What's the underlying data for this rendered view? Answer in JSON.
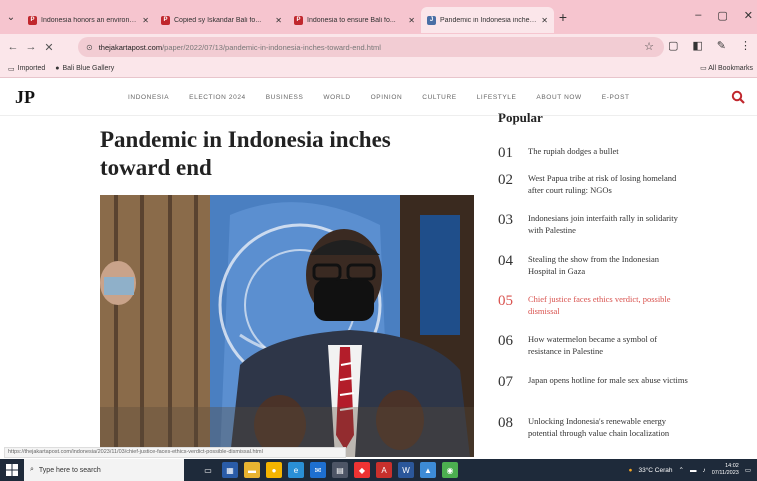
{
  "browser": {
    "tabs": [
      {
        "label": "Indonesia honors an environmental ...",
        "fav": "P",
        "fav_color": "#c0272d"
      },
      {
        "label": "Copied sy Iskandar Bali fo...",
        "fav": "P",
        "fav_color": "#c0272d"
      },
      {
        "label": "Indonesia to ensure Bali fo...",
        "fav": "P",
        "fav_color": "#c0272d"
      },
      {
        "label": "Pandemic in Indonesia inches ...",
        "fav": "J",
        "fav_color": "#4a6fa5"
      }
    ],
    "new_tab": "+",
    "window_controls": {
      "minimize": "–",
      "maximize": "▢",
      "close": "✕"
    },
    "nav": {
      "back": "←",
      "forward": "→",
      "reload": "✕",
      "site_info": "⊙"
    },
    "address": {
      "host": "thejakartapost.com",
      "path": "/paper/2022/07/13/pandemic-in-indonesia-inches-toward-end.html"
    },
    "star": "☆",
    "toolbar_icons": [
      "▢",
      "◧",
      "✎",
      "⋮"
    ],
    "bookmarks": [
      {
        "label": "Imported",
        "icon": "▭"
      },
      {
        "label": "Bali Blue Gallery",
        "icon": "●"
      }
    ],
    "all_bookmarks": "All Bookmarks"
  },
  "site": {
    "logo": "JP",
    "nav": [
      "INDONESIA",
      "ELECTION 2024",
      "BUSINESS",
      "WORLD",
      "OPINION",
      "CULTURE",
      "LIFESTYLE",
      "ABOUT NOW",
      "E-POST"
    ],
    "search_icon": "search-icon"
  },
  "article": {
    "title": "Pandemic in Indonesia inches toward end"
  },
  "sidebar": {
    "heading": "Popular",
    "items": [
      {
        "num": "01",
        "text": "The rupiah dodges a bullet"
      },
      {
        "num": "02",
        "text": "West Papua tribe at risk of losing homeland after court ruling: NGOs"
      },
      {
        "num": "03",
        "text": "Indonesians join interfaith rally in solidarity with Palestine"
      },
      {
        "num": "04",
        "text": "Stealing the show from the Indonesian Hospital in Gaza"
      },
      {
        "num": "05",
        "text": "Chief justice faces ethics verdict, possible dismissal"
      },
      {
        "num": "06",
        "text": "How watermelon became a symbol of resistance in Palestine"
      },
      {
        "num": "07",
        "text": "Japan opens hotline for male sex abuse victims"
      },
      {
        "num": "08",
        "text": "Unlocking Indonesia's renewable energy potential through value chain localization"
      }
    ],
    "highlight_index": 4
  },
  "status_url": "https://thejakartapost.com/indonesia/2023/11/03/chief-justice-faces-ethics-verdict-possible-dismissal.html",
  "taskbar": {
    "search_placeholder": "Type here to search",
    "weather": "33°C Cerah",
    "time": "14:02",
    "date": "07/11/2023"
  }
}
